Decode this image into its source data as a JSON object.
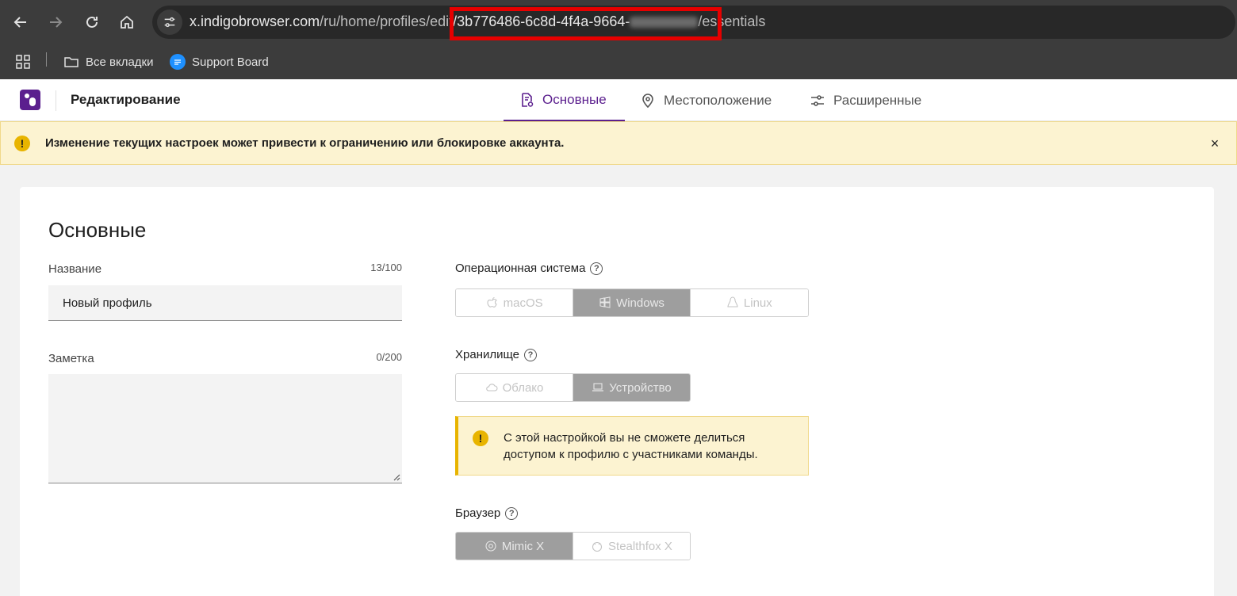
{
  "browser": {
    "url_host": "x.indigobrowser.com",
    "url_path_before": "/ru/home/profiles/edit",
    "url_id_visible": "/3b776486-6c8d-4f4a-9664-",
    "url_path_after": "/essentials",
    "bookmarks": [
      {
        "label": "Все вкладки",
        "icon": "folder-icon"
      },
      {
        "label": "Support Board",
        "icon": "support-board-icon"
      }
    ]
  },
  "header": {
    "title": "Редактирование",
    "tabs": [
      {
        "label": "Основные",
        "icon": "document-gear-icon",
        "active": true
      },
      {
        "label": "Местоположение",
        "icon": "location-pin-icon",
        "active": false
      },
      {
        "label": "Расширенные",
        "icon": "sliders-icon",
        "active": false
      }
    ]
  },
  "banner": {
    "text": "Изменение текущих настроек может привести к ограничению или блокировке аккаунта.",
    "close": "×"
  },
  "card": {
    "title": "Основные",
    "name_field": {
      "label": "Название",
      "counter": "13/100",
      "value": "Новый профиль"
    },
    "note_field": {
      "label": "Заметка",
      "counter": "0/200",
      "value": ""
    },
    "os": {
      "label": "Операционная система",
      "options": [
        "macOS",
        "Windows",
        "Linux"
      ],
      "selected": "Windows"
    },
    "storage": {
      "label": "Хранилище",
      "options": [
        "Облако",
        "Устройство"
      ],
      "selected": "Устройство",
      "notice": "С этой настройкой вы не сможете делиться доступом к профилю с участниками команды."
    },
    "browser": {
      "label": "Браузер",
      "options": [
        "Mimic X",
        "Stealthfox X"
      ],
      "selected": "Mimic X"
    }
  },
  "colors": {
    "brand": "#5b1f8e",
    "warning": "#e8b400",
    "warning_bg": "#fcf3d1",
    "highlight_box": "#e60000"
  }
}
